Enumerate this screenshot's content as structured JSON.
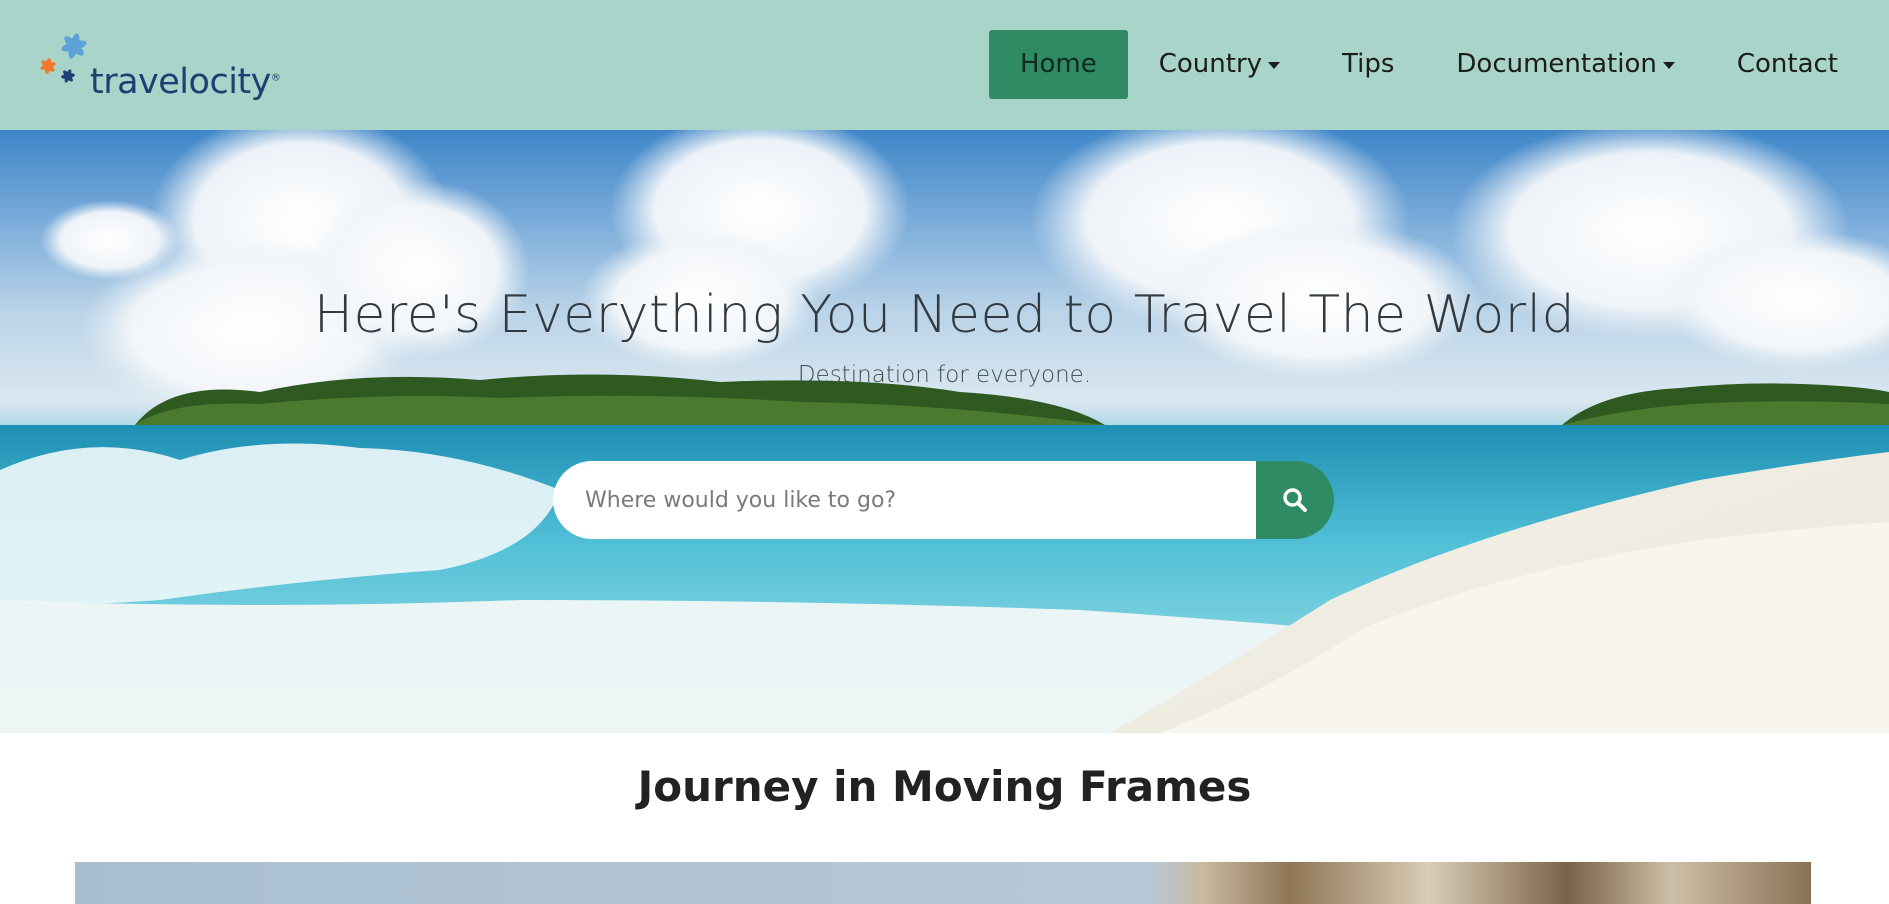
{
  "brand": {
    "logo_text": "travelocity",
    "logo_mark": "®",
    "colors": {
      "navbar_bg": "#a8d4c9",
      "accent_green": "#2e8b63",
      "logo_blue": "#1f3e72",
      "star_orange": "#f07a2c",
      "star_lightblue": "#5aa2d8"
    }
  },
  "nav": {
    "items": [
      {
        "label": "Home",
        "active": true,
        "dropdown": false
      },
      {
        "label": "Country",
        "active": false,
        "dropdown": true
      },
      {
        "label": "Tips",
        "active": false,
        "dropdown": false
      },
      {
        "label": "Documentation",
        "active": false,
        "dropdown": true
      },
      {
        "label": "Contact",
        "active": false,
        "dropdown": false
      }
    ]
  },
  "hero": {
    "title": "Here's Everything You Need to Travel The World",
    "subtitle": "Destination for everyone.",
    "search": {
      "placeholder": "Where would you like to go?",
      "value": "",
      "button_icon": "search-icon"
    },
    "background": "tropical beach with clouds, islands and waves"
  },
  "section": {
    "title": "Journey in Moving Frames"
  }
}
